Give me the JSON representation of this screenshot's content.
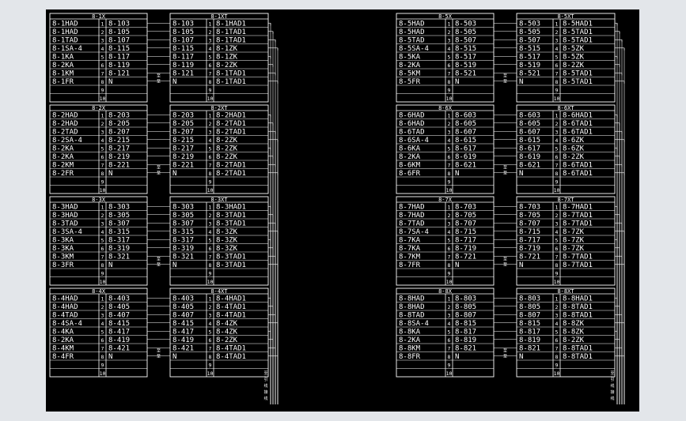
{
  "title": "",
  "panels": [
    {
      "left": "8-1X",
      "right": "8-1XT",
      "a": [
        "8-1HAD",
        "8-1HAD",
        "8-1TAD",
        "8-1SA-4",
        "8-1KA",
        "8-2KA",
        "8-1KM",
        "8-1FR",
        "",
        ""
      ],
      "b": [
        "8-103",
        "8-105",
        "8-107",
        "8-115",
        "8-117",
        "8-119",
        "8-121",
        "N",
        "",
        ""
      ],
      "c": [
        "8-103",
        "8-105",
        "8-107",
        "8-115",
        "8-117",
        "8-119",
        "8-121",
        "N",
        "",
        ""
      ],
      "d": [
        "8-1HAD1",
        "8-1TAD1",
        "8-1TAD1",
        "8-1ZK",
        "8-1ZK",
        "8-2ZK",
        "8-1TAD1",
        "8-1TAD1",
        "",
        ""
      ]
    },
    {
      "left": "8-2X",
      "right": "8-2XT",
      "a": [
        "8-2HAD",
        "8-2HAD",
        "8-2TAD",
        "8-2SA-4",
        "8-2KA",
        "8-2KA",
        "8-2KM",
        "8-2FR",
        "",
        ""
      ],
      "b": [
        "8-203",
        "8-205",
        "8-207",
        "8-215",
        "8-217",
        "8-219",
        "8-221",
        "N",
        "",
        ""
      ],
      "c": [
        "8-203",
        "8-205",
        "8-207",
        "8-215",
        "8-217",
        "8-219",
        "8-221",
        "N",
        "",
        ""
      ],
      "d": [
        "8-2HAD1",
        "8-2TAD1",
        "8-2TAD1",
        "8-2ZK",
        "8-2ZK",
        "8-2ZK",
        "8-2TAD1",
        "8-2TAD1",
        "",
        ""
      ]
    },
    {
      "left": "8-3X",
      "right": "8-3XT",
      "a": [
        "8-3HAD",
        "8-3HAD",
        "8-3TAD",
        "8-3SA-4",
        "8-3KA",
        "8-3KA",
        "8-3KM",
        "8-3FR",
        "",
        ""
      ],
      "b": [
        "8-303",
        "8-305",
        "8-307",
        "8-315",
        "8-317",
        "8-319",
        "8-321",
        "N",
        "",
        ""
      ],
      "c": [
        "8-303",
        "8-305",
        "8-307",
        "8-315",
        "8-317",
        "8-319",
        "8-321",
        "N",
        "",
        ""
      ],
      "d": [
        "8-3HAD1",
        "8-3TAD1",
        "8-3TAD1",
        "8-3ZK",
        "8-3ZK",
        "8-3ZK",
        "8-3TAD1",
        "8-3TAD1",
        "",
        ""
      ]
    },
    {
      "left": "8-4X",
      "right": "8-4XT",
      "a": [
        "8-4HAD",
        "8-4HAD",
        "8-4TAD",
        "8-4SA-4",
        "8-4KA",
        "8-2KA",
        "8-4KM",
        "8-4FR",
        "",
        ""
      ],
      "b": [
        "8-403",
        "8-405",
        "8-407",
        "8-415",
        "8-417",
        "8-419",
        "8-421",
        "N",
        "",
        ""
      ],
      "c": [
        "8-403",
        "8-405",
        "8-407",
        "8-415",
        "8-417",
        "8-419",
        "8-421",
        "N",
        "",
        ""
      ],
      "d": [
        "8-4HAD1",
        "8-4TAD1",
        "8-4TAD1",
        "8-4ZK",
        "8-4ZK",
        "8-2ZK",
        "8-4TAD1",
        "8-4TAD1",
        "",
        ""
      ]
    },
    {
      "left": "8-5X",
      "right": "8-5XT",
      "a": [
        "8-5HAD",
        "8-5HAD",
        "8-5TAD",
        "8-5SA-4",
        "8-5KA",
        "8-2KA",
        "8-5KM",
        "8-5FR",
        "",
        ""
      ],
      "b": [
        "8-503",
        "8-505",
        "8-507",
        "8-515",
        "8-517",
        "8-519",
        "8-521",
        "N",
        "",
        ""
      ],
      "c": [
        "8-503",
        "8-505",
        "8-507",
        "8-515",
        "8-517",
        "8-519",
        "8-521",
        "N",
        "",
        ""
      ],
      "d": [
        "8-5HAD1",
        "8-5TAD1",
        "8-5TAD1",
        "8-5ZK",
        "8-5ZK",
        "8-2ZK",
        "8-5TAD1",
        "8-5TAD1",
        "",
        ""
      ]
    },
    {
      "left": "8-6X",
      "right": "8-6XT",
      "a": [
        "8-6HAD",
        "8-6HAD",
        "8-6TAD",
        "8-6SA-4",
        "8-6KA",
        "8-2KA",
        "8-6KM",
        "8-6FR",
        "",
        ""
      ],
      "b": [
        "8-603",
        "8-605",
        "8-607",
        "8-615",
        "8-617",
        "8-619",
        "8-621",
        "N",
        "",
        ""
      ],
      "c": [
        "8-603",
        "8-605",
        "8-607",
        "8-615",
        "8-617",
        "8-619",
        "8-621",
        "N",
        "",
        ""
      ],
      "d": [
        "8-6HAD1",
        "8-6TAD1",
        "8-6TAD1",
        "8-6ZK",
        "8-6ZK",
        "8-2ZK",
        "8-6TAD1",
        "8-6TAD1",
        "",
        ""
      ]
    },
    {
      "left": "8-7X",
      "right": "8-7XT",
      "a": [
        "8-7HAD",
        "8-7HAD",
        "8-7TAD",
        "8-7SA-4",
        "8-7KA",
        "8-7KA",
        "8-7KM",
        "8-7FR",
        "",
        ""
      ],
      "b": [
        "8-703",
        "8-705",
        "8-707",
        "8-715",
        "8-717",
        "8-719",
        "8-721",
        "N",
        "",
        ""
      ],
      "c": [
        "8-703",
        "8-705",
        "8-707",
        "8-715",
        "8-717",
        "8-719",
        "8-721",
        "N",
        "",
        ""
      ],
      "d": [
        "8-7HAD1",
        "8-7TAD1",
        "8-7TAD1",
        "8-7ZK",
        "8-7ZK",
        "8-7ZK",
        "8-7TAD1",
        "8-7TAD1",
        "",
        ""
      ]
    },
    {
      "left": "8-8X",
      "right": "8-8XT",
      "a": [
        "8-8HAD",
        "8-8HAD",
        "8-8TAD",
        "8-8SA-4",
        "8-8KA",
        "8-2KA",
        "8-8KM",
        "8-8FR",
        "",
        ""
      ],
      "b": [
        "8-803",
        "8-805",
        "8-807",
        "8-815",
        "8-817",
        "8-819",
        "8-821",
        "N",
        "",
        ""
      ],
      "c": [
        "8-803",
        "8-805",
        "8-807",
        "8-815",
        "8-817",
        "8-819",
        "8-821",
        "N",
        "",
        ""
      ],
      "d": [
        "8-8HAD1",
        "8-8TAD1",
        "8-8TAD1",
        "8-8ZK",
        "8-8ZK",
        "8-2ZK",
        "8-8TAD1",
        "8-8TAD1",
        "",
        ""
      ]
    }
  ],
  "terminal_numbers": [
    "1",
    "2",
    "3",
    "4",
    "5",
    "6",
    "7",
    "8",
    "9",
    "10"
  ],
  "mid_tags": [
    "至",
    "至",
    "至",
    "至",
    "至",
    "至",
    "至",
    "至"
  ],
  "side_notes": [
    {
      "text": "至引线接线"
    },
    {
      "text": "至引线接线"
    }
  ],
  "colors": {
    "background": "#000000",
    "line": "#ffffff",
    "frame": "#e3e6ea"
  }
}
